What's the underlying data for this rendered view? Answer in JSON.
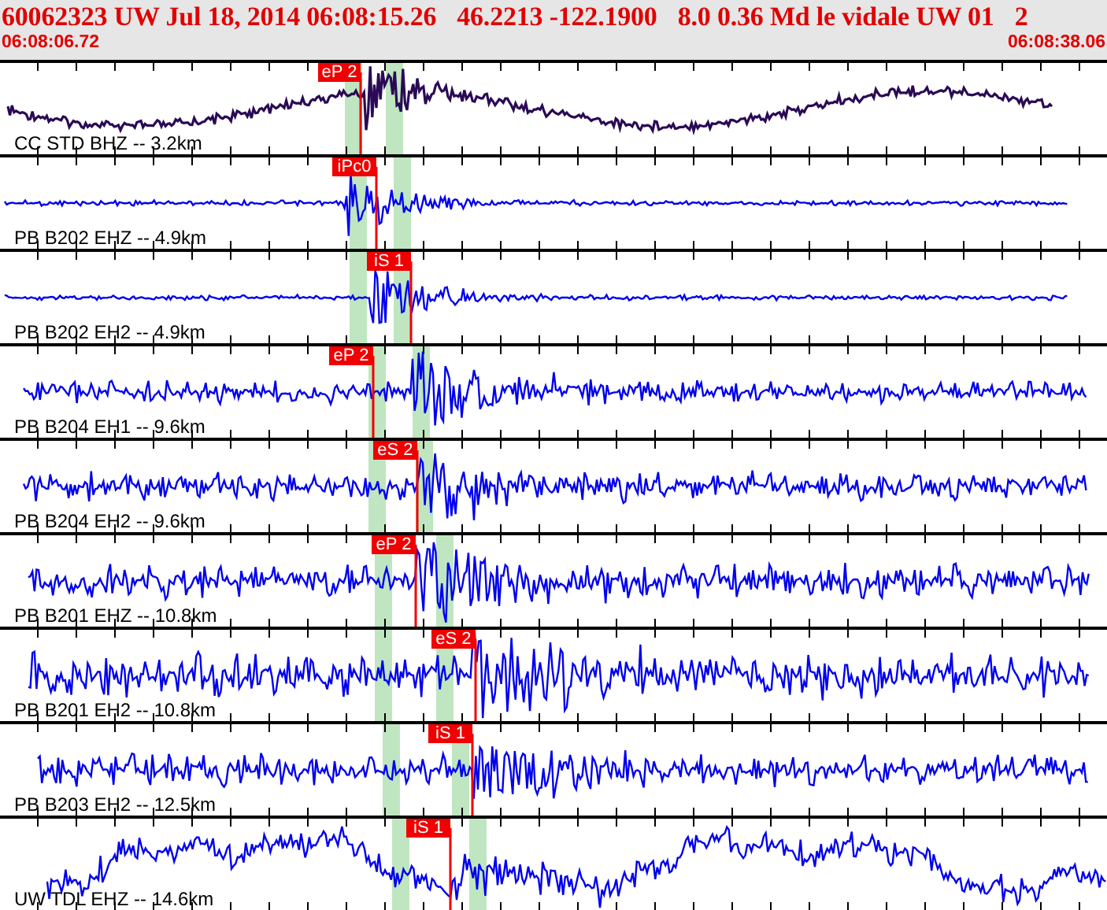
{
  "header": {
    "event": "60062323 UW Jul 18, 2014 06:08:15.26",
    "location": "46.2213 -122.1900",
    "details": "8.0 0.36 Md le vidale UW 01",
    "extra": "2",
    "start_time": "06:08:06.72",
    "end_time": "06:08:38.06"
  },
  "traces": [
    {
      "label": "CC STD BHZ -- 3.2km",
      "pick": "eP 2",
      "color": "#2a0a55"
    },
    {
      "label": "PB B202 EHZ -- 4.9km",
      "pick": "iPc0",
      "color": "#0000ee"
    },
    {
      "label": "PB B202 EH2 -- 4.9km",
      "pick": "iS 1",
      "color": "#0000ee"
    },
    {
      "label": "PB B204 EH1 -- 9.6km",
      "pick": "eP 2",
      "color": "#0000ee"
    },
    {
      "label": "PB B204 EH2 -- 9.6km",
      "pick": "eS 2",
      "color": "#0000ee"
    },
    {
      "label": "PB B201 EHZ -- 10.8km",
      "pick": "eP 2",
      "color": "#0000ee"
    },
    {
      "label": "PB B201 EH2 -- 10.8km",
      "pick": "eS 2",
      "color": "#0000ee"
    },
    {
      "label": "PB B203 EH2 -- 12.5km",
      "pick": "iS 1",
      "color": "#0000ee"
    },
    {
      "label": "UW TDL EHZ -- 14.6km",
      "pick": "iS 1",
      "color": "#0000ee"
    }
  ]
}
